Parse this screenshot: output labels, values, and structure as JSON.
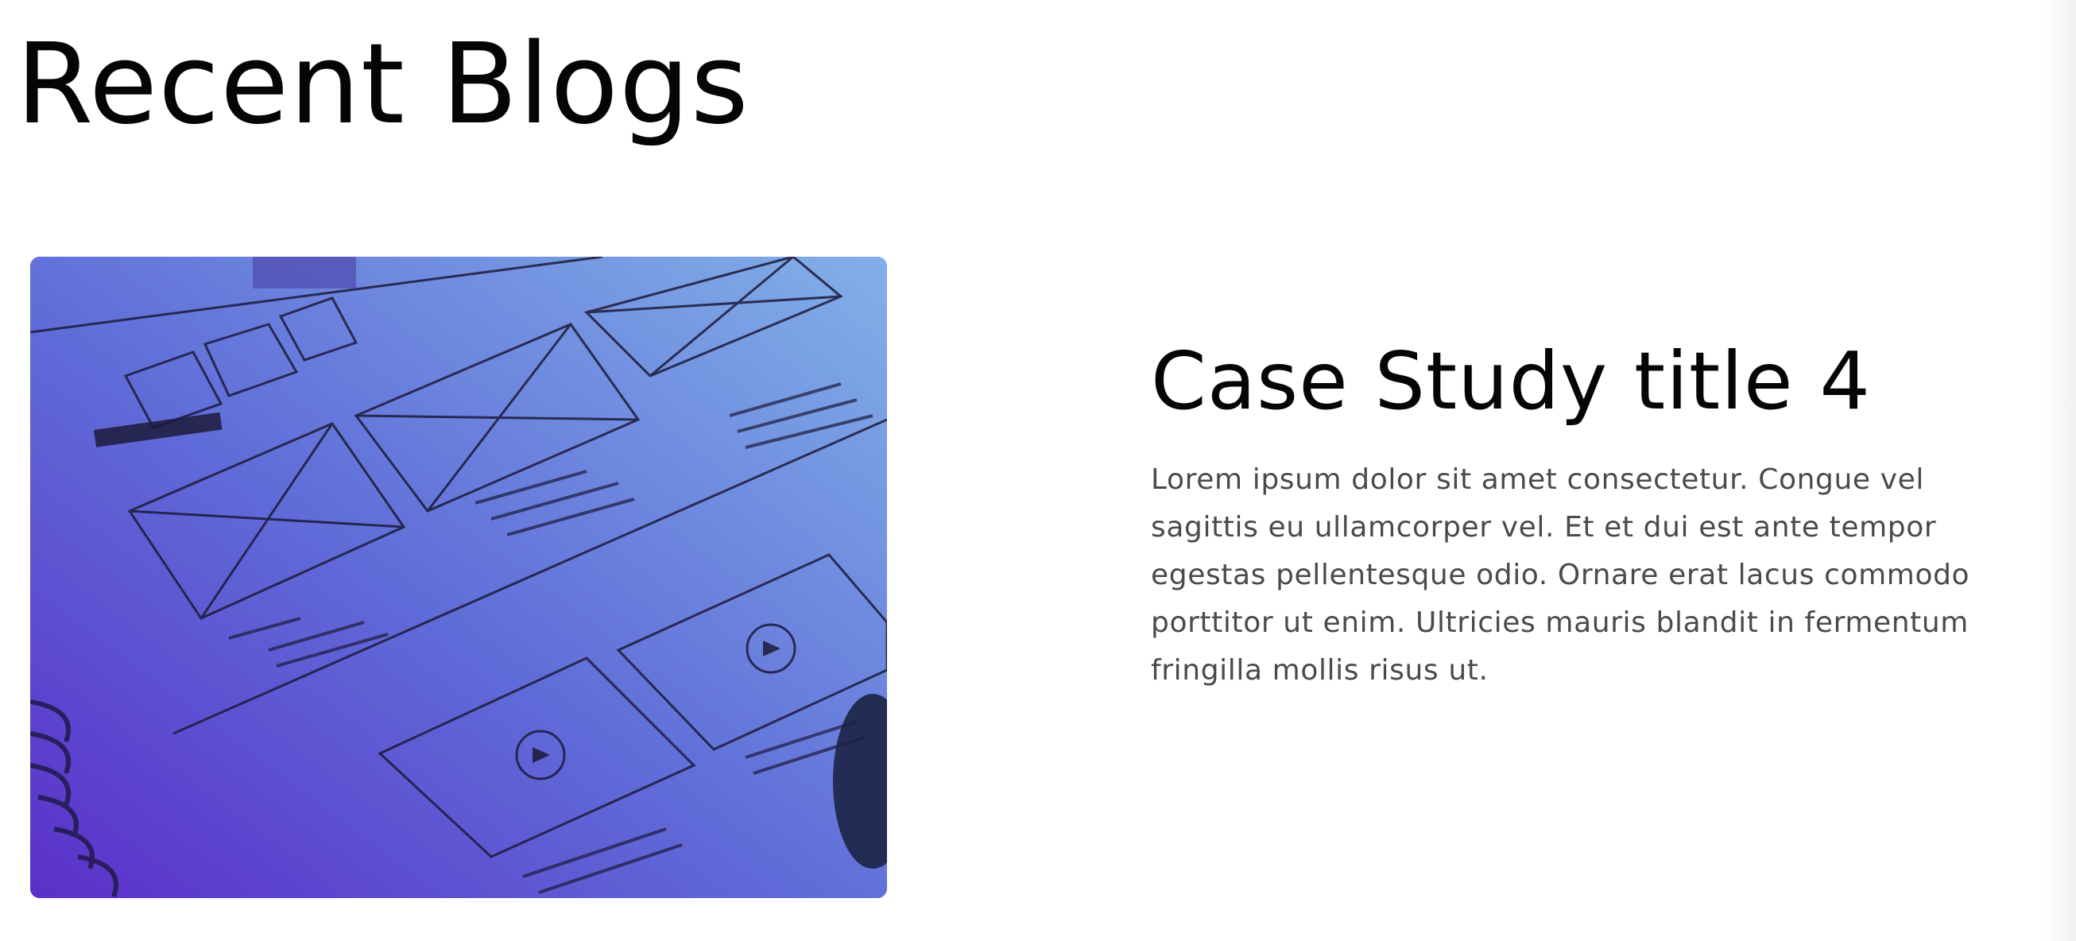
{
  "section": {
    "title": "Recent Blogs"
  },
  "blog": {
    "title": "Case Study title 4",
    "excerpt": "Lorem ipsum dolor sit amet consectetur. Congue vel sagittis eu ullamcorper vel. Et et dui est ante tempor egestas pellentesque odio. Ornare erat lacus commodo porttitor ut enim. Ultricies mauris blandit in fermentum fringilla mollis risus ut.",
    "image_icon": "wireframe-sketch-image"
  },
  "colors": {
    "title": "#050505",
    "body_text": "#4a4a4a",
    "image_gradient_start": "#6a3fd6",
    "image_gradient_end": "#7aa6e4"
  }
}
